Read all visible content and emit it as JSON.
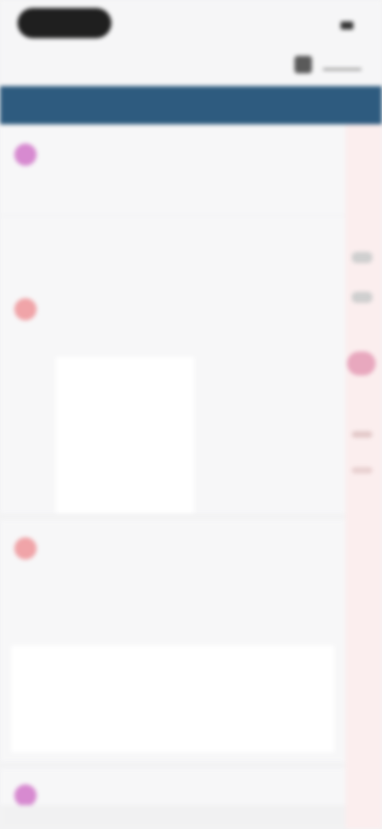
{
  "status_bar": {
    "time": "",
    "battery_label": ""
  },
  "toolbar": {
    "title": "",
    "icon": "share-icon"
  },
  "banner": {
    "title": ""
  },
  "sections": [
    {
      "title": "",
      "subtitle": "",
      "link": ""
    },
    {
      "title": "",
      "subtitle": "",
      "header_left": "",
      "header_right": "",
      "rows": [
        {
          "label": "",
          "value": ""
        },
        {
          "label": "",
          "value": ""
        }
      ]
    },
    {
      "title": "",
      "subtitle": "",
      "tab_left": "",
      "tab_right": "",
      "cols": [
        "",
        "",
        ""
      ],
      "cell": ""
    },
    {
      "title": "",
      "subtitle": ""
    }
  ],
  "sidebar": {
    "items": [
      "",
      "",
      "",
      "",
      ""
    ]
  },
  "colors": {
    "banner": "#2e5b7f",
    "accent": "#d9667f",
    "sidebar_bg": "#fbeeee"
  }
}
